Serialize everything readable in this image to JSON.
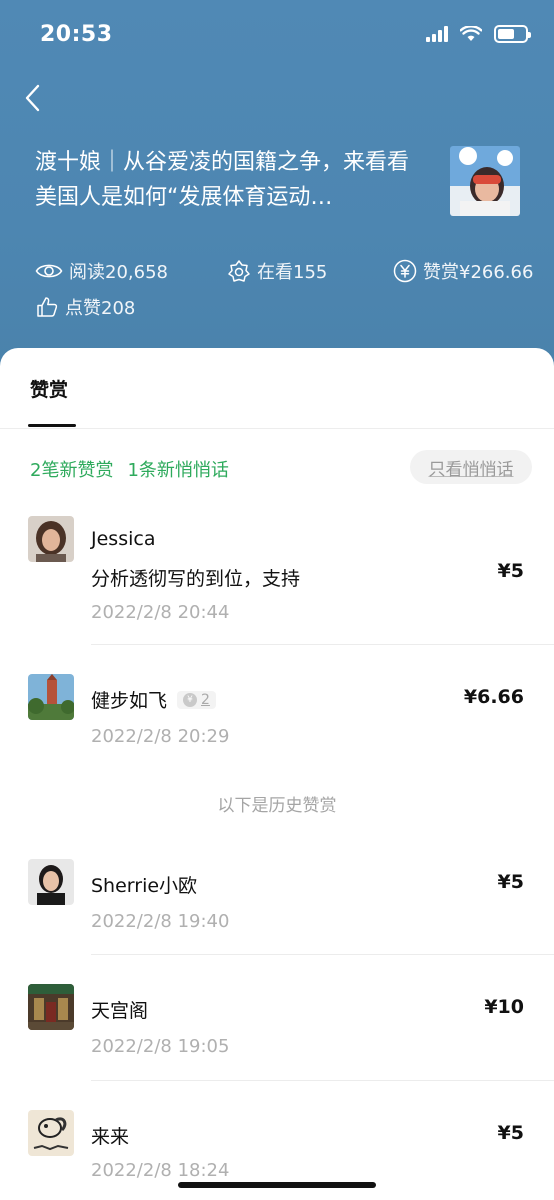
{
  "status_bar": {
    "time": "20:53"
  },
  "article": {
    "title": "渡十娘｜从谷爱凌的国籍之争，来看看美国人是如何“发展体育运动…",
    "stats": {
      "read": "阅读20,658",
      "watching": "在看155",
      "reward_total": "赞赏¥266.66",
      "likes": "点赞208"
    }
  },
  "sheet": {
    "tab_label": "赞赏",
    "new_rewards": "2笔新赞赏",
    "new_whispers": "1条新悄悄话",
    "filter_label": "只看悄悄话",
    "history_label": "以下是历史赞赏"
  },
  "rewards": [
    {
      "name": "Jessica",
      "message": "分析透彻写的到位，支持",
      "time": "2022/2/8 20:44",
      "amount": "¥5"
    },
    {
      "name": "健步如飞",
      "badge_level": "2",
      "time": "2022/2/8 20:29",
      "amount": "¥6.66"
    },
    {
      "name": "Sherrie小欧",
      "time": "2022/2/8 19:40",
      "amount": "¥5"
    },
    {
      "name": "天宫阁",
      "time": "2022/2/8 19:05",
      "amount": "¥10"
    },
    {
      "name": "来来",
      "time": "2022/2/8 18:24",
      "amount": "¥5"
    }
  ],
  "colors": {
    "header_bg": "#4d86b1",
    "accent_green": "#2eaa5c"
  }
}
